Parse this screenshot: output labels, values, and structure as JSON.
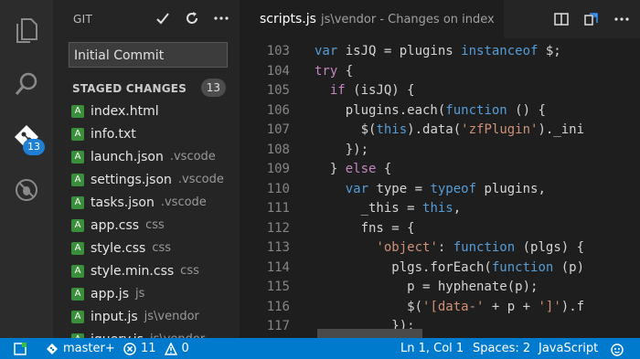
{
  "activity_bar": {
    "scm_badge": "13"
  },
  "sidebar": {
    "title": "GIT",
    "commit_message": "Initial Commit",
    "staged_label": "STAGED CHANGES",
    "staged_count": "13",
    "files": [
      {
        "status": "A",
        "name": "index.html",
        "dir": ""
      },
      {
        "status": "A",
        "name": "info.txt",
        "dir": ""
      },
      {
        "status": "A",
        "name": "launch.json",
        "dir": ".vscode"
      },
      {
        "status": "A",
        "name": "settings.json",
        "dir": ".vscode"
      },
      {
        "status": "A",
        "name": "tasks.json",
        "dir": ".vscode"
      },
      {
        "status": "A",
        "name": "app.css",
        "dir": "css"
      },
      {
        "status": "A",
        "name": "style.css",
        "dir": "css"
      },
      {
        "status": "A",
        "name": "style.min.css",
        "dir": "css"
      },
      {
        "status": "A",
        "name": "app.js",
        "dir": "js"
      },
      {
        "status": "A",
        "name": "input.js",
        "dir": "js\\vendor"
      },
      {
        "status": "A",
        "name": "jquery.js",
        "dir": "js\\vendor"
      }
    ]
  },
  "tab": {
    "filename": "scripts.js",
    "description": "js\\vendor - Changes on index"
  },
  "editor": {
    "lines": [
      {
        "num": "103",
        "tokens": [
          [
            "kw",
            "var "
          ],
          [
            "plain",
            "isJQ = plugins "
          ],
          [
            "kw",
            "instanceof"
          ],
          [
            "plain",
            " $;"
          ]
        ]
      },
      {
        "num": "104",
        "tokens": [
          [
            "ctl",
            "try"
          ],
          [
            "plain",
            " {"
          ]
        ]
      },
      {
        "num": "105",
        "tokens": [
          [
            "plain",
            "  "
          ],
          [
            "ctl",
            "if"
          ],
          [
            "plain",
            " (isJQ) {"
          ]
        ]
      },
      {
        "num": "106",
        "tokens": [
          [
            "plain",
            "    plugins.each("
          ],
          [
            "kw",
            "function"
          ],
          [
            "plain",
            " () {"
          ]
        ]
      },
      {
        "num": "107",
        "tokens": [
          [
            "plain",
            "      $("
          ],
          [
            "kw",
            "this"
          ],
          [
            "plain",
            ").data("
          ],
          [
            "str",
            "'zfPlugin'"
          ],
          [
            "plain",
            ")._ini"
          ]
        ]
      },
      {
        "num": "108",
        "tokens": [
          [
            "plain",
            "    });"
          ]
        ]
      },
      {
        "num": "109",
        "tokens": [
          [
            "plain",
            "  } "
          ],
          [
            "ctl",
            "else"
          ],
          [
            "plain",
            " {"
          ]
        ]
      },
      {
        "num": "110",
        "tokens": [
          [
            "plain",
            "    "
          ],
          [
            "kw",
            "var"
          ],
          [
            "plain",
            " type = "
          ],
          [
            "kw",
            "typeof"
          ],
          [
            "plain",
            " plugins,"
          ]
        ]
      },
      {
        "num": "111",
        "tokens": [
          [
            "plain",
            "      _this = "
          ],
          [
            "kw",
            "this"
          ],
          [
            "plain",
            ","
          ]
        ]
      },
      {
        "num": "112",
        "tokens": [
          [
            "plain",
            "      fns = {"
          ]
        ]
      },
      {
        "num": "113",
        "tokens": [
          [
            "plain",
            "        "
          ],
          [
            "str",
            "'object'"
          ],
          [
            "plain",
            ": "
          ],
          [
            "kw",
            "function"
          ],
          [
            "plain",
            " (plgs) {"
          ]
        ]
      },
      {
        "num": "114",
        "tokens": [
          [
            "plain",
            "          plgs.forEach("
          ],
          [
            "kw",
            "function"
          ],
          [
            "plain",
            " (p)"
          ]
        ]
      },
      {
        "num": "115",
        "tokens": [
          [
            "plain",
            "            p = hyphenate(p);"
          ]
        ]
      },
      {
        "num": "116",
        "tokens": [
          [
            "plain",
            "            $("
          ],
          [
            "str",
            "'[data-'"
          ],
          [
            "plain",
            " + p + "
          ],
          [
            "str",
            "']'"
          ],
          [
            "plain",
            ").f"
          ]
        ]
      },
      {
        "num": "117",
        "tokens": [
          [
            "plain",
            "          });"
          ]
        ]
      }
    ]
  },
  "status_bar": {
    "branch": "master+",
    "errors": "11",
    "warnings": "0",
    "cursor": "Ln 1, Col 1",
    "spaces": "Spaces: 2",
    "language": "JavaScript"
  },
  "colors": {
    "status_bar": "#007acc",
    "badge": "#1f7fd4",
    "added": "#3a8f3a",
    "keyword": "#569cd6",
    "control": "#c586c0",
    "string": "#ce9178"
  }
}
